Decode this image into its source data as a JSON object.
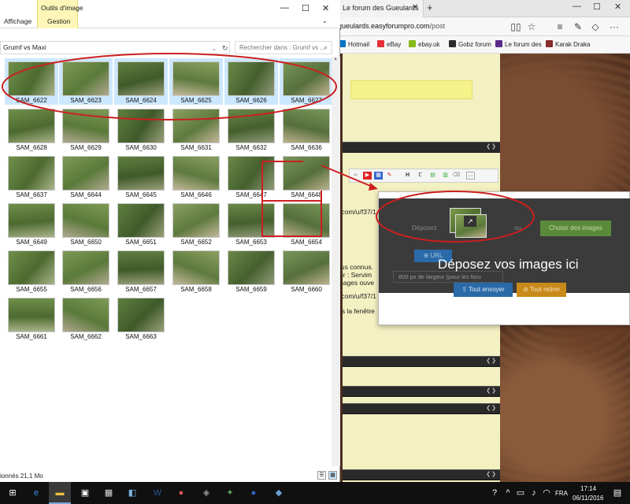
{
  "explorer": {
    "tabs": {
      "view": "Affichage",
      "context_group": "Outils d'image",
      "manage": "Gestion"
    },
    "address": "Grumf vs Maxi",
    "search_placeholder": "Rechercher dans : Grumf vs ...",
    "thumbnails": [
      {
        "label": "SAM_6622",
        "selected": true
      },
      {
        "label": "SAM_6623",
        "selected": true
      },
      {
        "label": "SAM_6624",
        "selected": true
      },
      {
        "label": "SAM_6625",
        "selected": true
      },
      {
        "label": "SAM_6626",
        "selected": true
      },
      {
        "label": "SAM_6627",
        "selected": true
      },
      {
        "label": "SAM_6628",
        "selected": false
      },
      {
        "label": "SAM_6629",
        "selected": false
      },
      {
        "label": "SAM_6630",
        "selected": false
      },
      {
        "label": "SAM_6631",
        "selected": false
      },
      {
        "label": "SAM_6632",
        "selected": false
      },
      {
        "label": "SAM_6636",
        "selected": false
      },
      {
        "label": "SAM_6637",
        "selected": false
      },
      {
        "label": "SAM_6644",
        "selected": false
      },
      {
        "label": "SAM_6645",
        "selected": false
      },
      {
        "label": "SAM_6646",
        "selected": false
      },
      {
        "label": "SAM_6647",
        "selected": false
      },
      {
        "label": "SAM_6648",
        "selected": false
      },
      {
        "label": "SAM_6649",
        "selected": false
      },
      {
        "label": "SAM_6650",
        "selected": false
      },
      {
        "label": "SAM_6651",
        "selected": false
      },
      {
        "label": "SAM_6652",
        "selected": false
      },
      {
        "label": "SAM_6653",
        "selected": false
      },
      {
        "label": "SAM_6654",
        "selected": false
      },
      {
        "label": "SAM_6655",
        "selected": false
      },
      {
        "label": "SAM_6656",
        "selected": false
      },
      {
        "label": "SAM_6657",
        "selected": false
      },
      {
        "label": "SAM_6658",
        "selected": false
      },
      {
        "label": "SAM_6659",
        "selected": false
      },
      {
        "label": "SAM_6660",
        "selected": false
      },
      {
        "label": "SAM_6661",
        "selected": false
      },
      {
        "label": "SAM_6662",
        "selected": false
      },
      {
        "label": "SAM_6663",
        "selected": false
      }
    ],
    "status": "ionnés  21,1 Mo"
  },
  "browser": {
    "tab_title": "Le forum des Gueulards",
    "url_prefix": "gueulards.easyforumpro.com",
    "url_path": "/post",
    "favorites": [
      "Hotmail",
      "eBay",
      "ebay.uk",
      "Gobz forum",
      "Le forum des",
      "Karak Draka"
    ],
    "text_lines": [
      ".com/u/f37/1",
      "lus connus.",
      "ur : Servim",
      " pages ouve",
      ".com/u/f37/1",
      "rs la fenêtre"
    ]
  },
  "drop_dialog": {
    "prompt": "Déposez vos images ici",
    "ghost_text": "Déposez",
    "or_text": "ou",
    "choose_button": "Choisir des images",
    "url_button": "URL",
    "size_select": "800 px de largeur (pour les foru",
    "send_button": "Tout envoyer",
    "cancel_button": "Tout retirer"
  },
  "taskbar": {
    "lang": "FRA",
    "time": "17:14",
    "date": "06/11/2016"
  },
  "colors": {
    "selection": "#cce8ff",
    "annotation": "#cc1f1f",
    "context_tab": "#fdf6b8"
  }
}
